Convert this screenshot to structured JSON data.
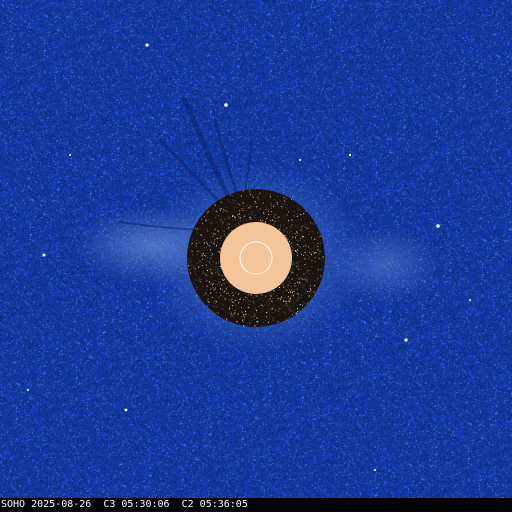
{
  "caption": {
    "text": "SOHO 2025-08-26  C3 05:30:06  C2 05:36:05"
  },
  "colors": {
    "background": "#1438a0",
    "background_dark": "#0e2a86",
    "corona_glow": "#5b86d8",
    "c2_disk": "#1a1410",
    "occulter": "#f4c49a",
    "sun_outline": "#ffffff",
    "star": "#ffffff",
    "caption_bar": "#000000",
    "caption_text": "#ffffff"
  }
}
